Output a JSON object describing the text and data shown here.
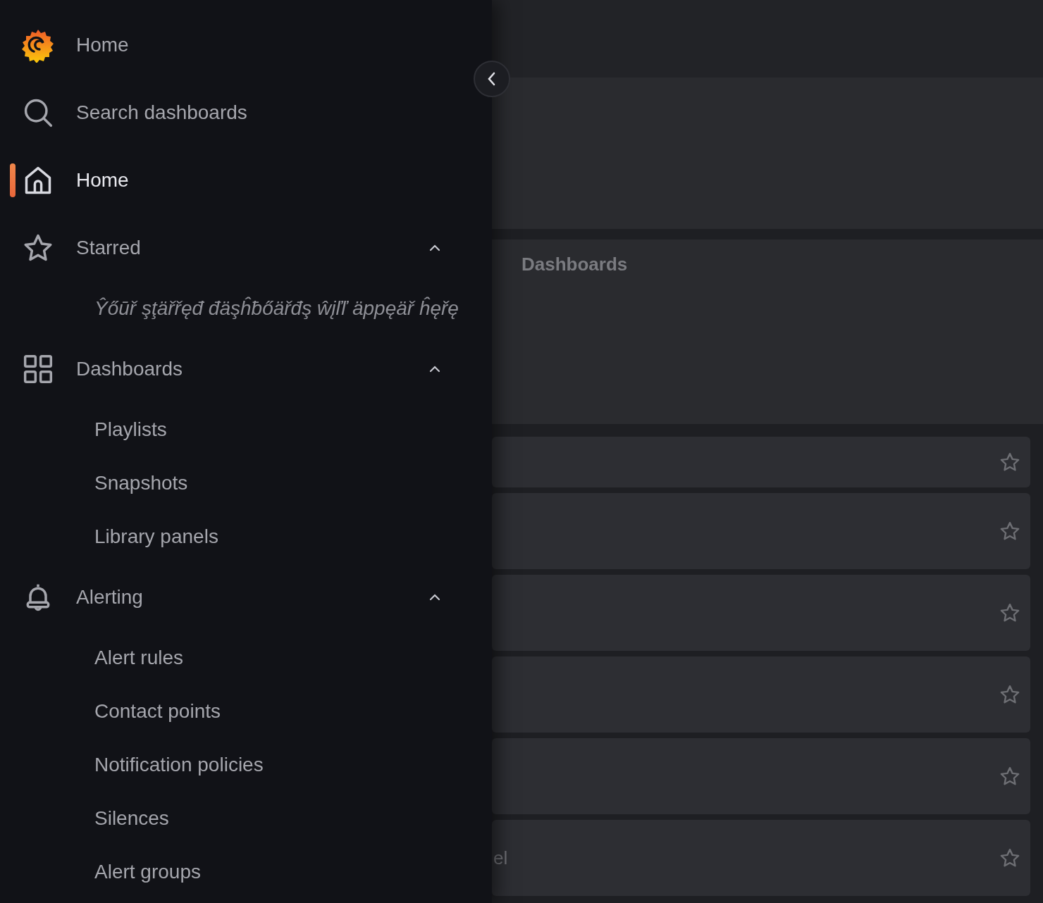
{
  "sidebar": {
    "logo_label": "Home",
    "collapse_button": {
      "expanded": true
    },
    "items": [
      {
        "kind": "search",
        "label": "Search dashboards",
        "selected": false
      },
      {
        "kind": "home",
        "label": "Home",
        "selected": true
      },
      {
        "kind": "star",
        "label": "Starred",
        "selected": false,
        "expanded": true,
        "empty_text": "Ŷőūř şţäřřęđ đäşĥƀőäřđş ŵįľľ äppęäř ĥęřę"
      },
      {
        "kind": "grid",
        "label": "Dashboards",
        "selected": false,
        "expanded": true,
        "children": [
          {
            "label": "Playlists",
            "selected": false
          },
          {
            "label": "Snapshots",
            "selected": false
          },
          {
            "label": "Library panels",
            "selected": false
          }
        ]
      },
      {
        "kind": "bell",
        "label": "Alerting",
        "selected": false,
        "expanded": true,
        "children": [
          {
            "label": "Alert rules",
            "selected": false
          },
          {
            "label": "Contact points",
            "selected": false
          },
          {
            "label": "Notification policies",
            "selected": false
          },
          {
            "label": "Silences",
            "selected": false
          },
          {
            "label": "Alert groups",
            "selected": false
          }
        ]
      }
    ]
  },
  "main": {
    "section_title": "Dashboards",
    "rows": [
      {
        "starred": false
      },
      {
        "starred": false
      },
      {
        "starred": false
      },
      {
        "starred": false
      },
      {
        "starred": false
      },
      {
        "starred": false,
        "label": "el"
      }
    ]
  }
}
